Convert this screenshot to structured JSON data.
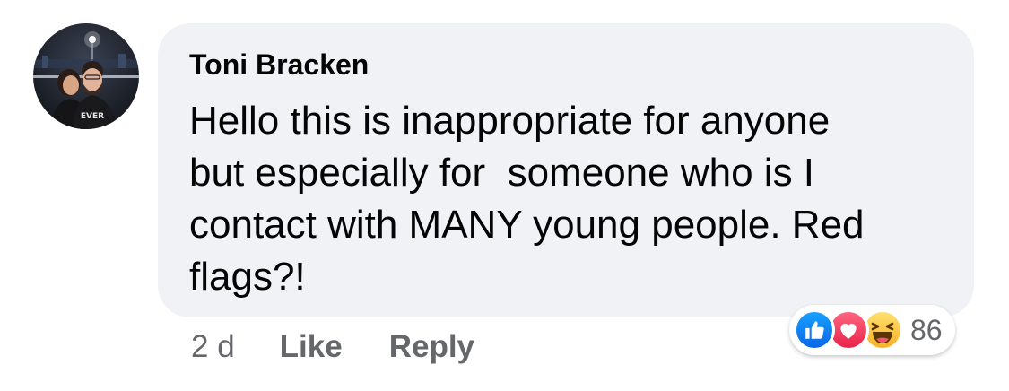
{
  "comment": {
    "author": "Toni Bracken",
    "text": "Hello this is inappropriate for anyone\nbut especially for  someone who is I\ncontact with MANY young people. Red\nflags?!",
    "avatar_shirt_text": "EVER",
    "timestamp": "2 d",
    "like_label": "Like",
    "reply_label": "Reply",
    "reactions": {
      "icons": [
        "like-icon",
        "love-icon",
        "haha-icon"
      ],
      "count": "86"
    }
  },
  "colors": {
    "bubble": "#f0f2f5",
    "meta_text": "#65676b",
    "text": "#050505",
    "like": "#1877f2",
    "love": "#f33e58",
    "haha": "#f7b125"
  }
}
